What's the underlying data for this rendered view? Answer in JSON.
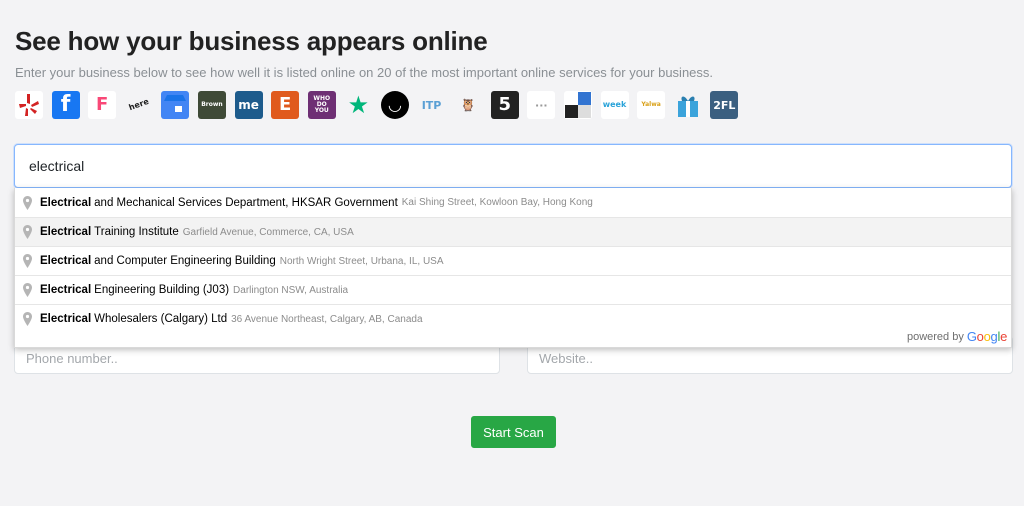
{
  "header": {
    "title": "See how your business appears online",
    "subtitle": "Enter your business below to see how well it is listed online on 20 of the most important online services for your business."
  },
  "services": [
    {
      "name": "yelp-icon",
      "text": "",
      "bg": "#ffffff",
      "fg": "#d32323"
    },
    {
      "name": "facebook-icon",
      "text": "f",
      "bg": "#1877f2",
      "fg": "#ffffff"
    },
    {
      "name": "foursquare-icon",
      "text": "F",
      "bg": "#ffffff",
      "fg": "#f94877"
    },
    {
      "name": "here-icon",
      "text": "here",
      "bg": "#f3f3f5",
      "fg": "#222222"
    },
    {
      "name": "google-my-business-icon",
      "text": "",
      "bg": "#4285f4",
      "fg": "#ffffff"
    },
    {
      "name": "brownbook-icon",
      "text": "Brown",
      "bg": "#3f4a37",
      "fg": "#ffffff"
    },
    {
      "name": "cylex-me-icon",
      "text": "me",
      "bg": "#1d5b8c",
      "fg": "#ffffff"
    },
    {
      "name": "etsy-e-icon",
      "text": "E",
      "bg": "#e05a1d",
      "fg": "#ffffff"
    },
    {
      "name": "who-do-you-icon",
      "text": "WHO DO YOU",
      "bg": "#6e2f74",
      "fg": "#ffffff"
    },
    {
      "name": "trustpilot-star-icon",
      "text": "★",
      "bg": "#f3f3f5",
      "fg": "#00b67a"
    },
    {
      "name": "nextdoor-smile-icon",
      "text": "◡",
      "bg": "#000000",
      "fg": "#ffffff"
    },
    {
      "name": "tupalo-icon",
      "text": "ITP",
      "bg": "#f3f3f5",
      "fg": "#5a9fd4"
    },
    {
      "name": "owl-icon",
      "text": "🦉",
      "bg": "#f3f3f5",
      "fg": "#e07a28"
    },
    {
      "name": "five-icon",
      "text": "5",
      "bg": "#222222",
      "fg": "#ffffff"
    },
    {
      "name": "placeholder-logo-icon",
      "text": "···",
      "bg": "#ffffff",
      "fg": "#999999"
    },
    {
      "name": "delicious-blocks-icon",
      "text": "",
      "bg": "#ffffff",
      "fg": "#3274d1"
    },
    {
      "name": "weekend-icon",
      "text": "week",
      "bg": "#ffffff",
      "fg": "#2aa3d9"
    },
    {
      "name": "yalwa-icon",
      "text": "Yalwa",
      "bg": "#ffffff",
      "fg": "#d9a11a"
    },
    {
      "name": "gift-box-icon",
      "text": "",
      "bg": "#f3f3f5",
      "fg": "#3ba3db"
    },
    {
      "name": "2fl-icon",
      "text": "2FL",
      "bg": "#3b5f80",
      "fg": "#ffffff"
    }
  ],
  "search": {
    "value": "electrical",
    "placeholder": ""
  },
  "suggestions": [
    {
      "bold": "Electrical",
      "rest": "and Mechanical Services Department, HKSAR Government",
      "address": "Kai Shing Street, Kowloon Bay, Hong Kong"
    },
    {
      "bold": "Electrical",
      "rest": "Training Institute",
      "address": "Garfield Avenue, Commerce, CA, USA"
    },
    {
      "bold": "Electrical",
      "rest": "and Computer Engineering Building",
      "address": "North Wright Street, Urbana, IL, USA"
    },
    {
      "bold": "Electrical",
      "rest": "Engineering Building (J03)",
      "address": "Darlington NSW, Australia"
    },
    {
      "bold": "Electrical",
      "rest": "Wholesalers (Calgary) Ltd",
      "address": "36 Avenue Northeast, Calgary, AB, Canada"
    }
  ],
  "powered_by": {
    "label": "powered by",
    "brand": "Google"
  },
  "fields": {
    "phone_placeholder": "Phone number..",
    "website_placeholder": "Website.."
  },
  "actions": {
    "start_scan_label": "Start Scan",
    "accent_color": "#28a745"
  }
}
